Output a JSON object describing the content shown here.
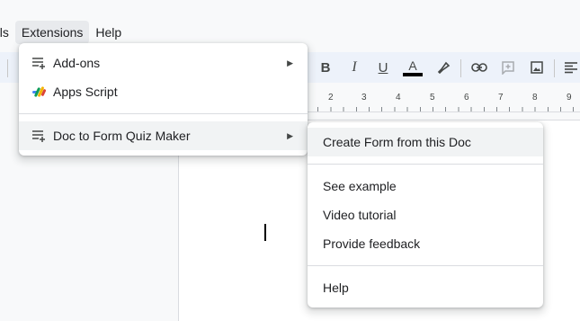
{
  "menubar": {
    "items": [
      "ols",
      "Extensions",
      "Help"
    ]
  },
  "extensions_menu": {
    "items": [
      {
        "label": "Add-ons",
        "icon": "add-ons-icon",
        "has_submenu": true
      },
      {
        "label": "Apps Script",
        "icon": "apps-script-icon",
        "has_submenu": false
      },
      {
        "label": "Doc to Form Quiz Maker",
        "icon": "add-on-app-icon",
        "has_submenu": true
      }
    ]
  },
  "quiz_maker_submenu": {
    "items": [
      {
        "label": "Create Form from this Doc"
      },
      {
        "label": "See example"
      },
      {
        "label": "Video tutorial"
      },
      {
        "label": "Provide feedback"
      },
      {
        "label": "Help"
      }
    ]
  },
  "toolbar": {
    "bold": "B",
    "italic": "I",
    "underline": "U",
    "text_color": "A"
  },
  "ruler": {
    "numbers": [
      "2",
      "3",
      "4",
      "5",
      "6",
      "7",
      "8",
      "9"
    ]
  },
  "colors": {
    "toolbar_bg": "#edf2fa",
    "menu_highlight": "#f1f3f4",
    "text_color_bar": "#000000"
  }
}
